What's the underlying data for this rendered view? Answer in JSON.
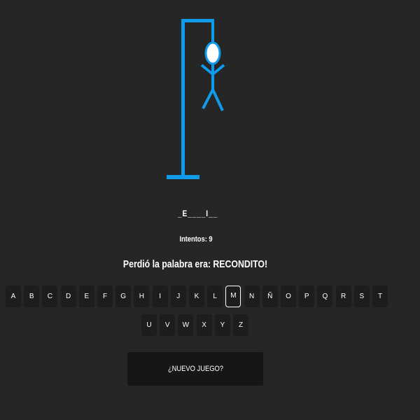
{
  "game": {
    "word_display": "_E____I__",
    "attempts_text": "Intentos: 9",
    "result_message": "Perdió la palabra era: RECONDITO!",
    "new_game_label": "¿NUEVO JUEGO?",
    "selected_letter": "M",
    "accent_color": "#0f9aea",
    "background_color": "#262626",
    "key_color": "#1d1d1d"
  },
  "keyboard": {
    "row1": [
      "A",
      "B",
      "C",
      "D",
      "E",
      "F",
      "G",
      "H",
      "I",
      "J",
      "K",
      "L",
      "M",
      "N",
      "Ñ",
      "O",
      "P",
      "Q",
      "R",
      "S",
      "T"
    ],
    "row2": [
      "U",
      "V",
      "W",
      "X",
      "Y",
      "Z"
    ]
  }
}
